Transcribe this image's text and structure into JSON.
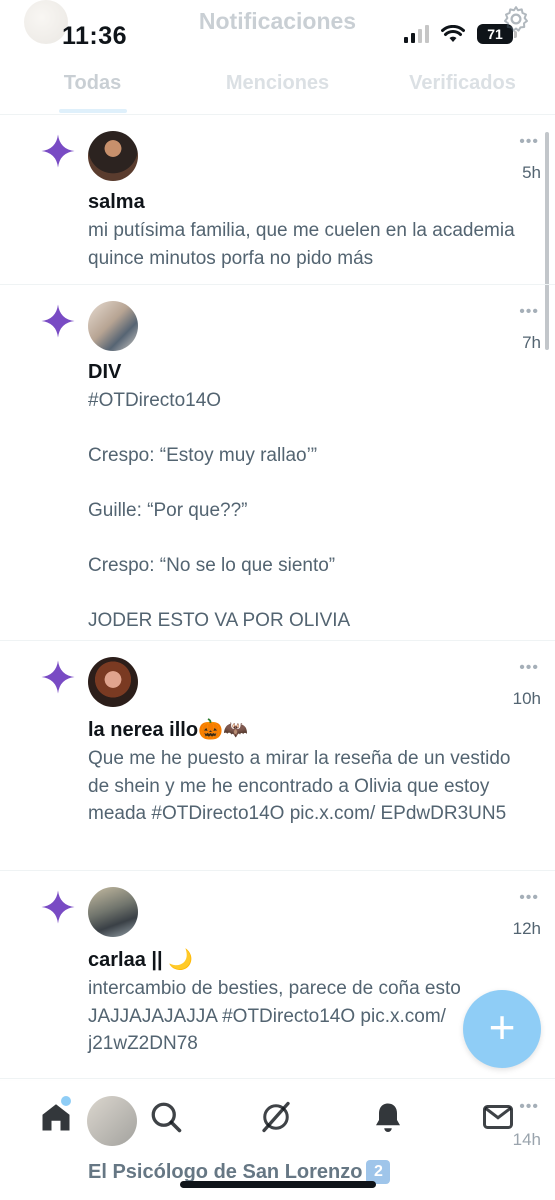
{
  "status_bar": {
    "time": "11:36",
    "battery": "71"
  },
  "header": {
    "title": "Notificaciones"
  },
  "tabs": [
    {
      "label": "Todas",
      "active": true
    },
    {
      "label": "Menciones",
      "active": false
    },
    {
      "label": "Verificados",
      "active": false
    }
  ],
  "notifications": [
    {
      "name": "salma",
      "time": "5h",
      "text": "mi putísima familia, que me cuelen en la academia quince minutos porfa no pido más"
    },
    {
      "name": "DIV",
      "time": "7h",
      "text": "#OTDirecto14O\n\nCrespo: “Estoy muy rallao’”\n\nGuille: “Por que??”\n\nCrespo: “No se lo que siento”\n\nJODER ESTO VA POR OLIVIA"
    },
    {
      "name": "la nerea illo🎃🦇",
      "time": "10h",
      "text": "Que me he puesto a mirar la reseña de un vestido de shein y me he encontrado a Olivia que estoy meada #OTDirecto14O pic.x.com/ EPdwDR3UN5"
    },
    {
      "name": "carlaa || 🌙",
      "time": "12h",
      "text": "intercambio de besties, parece de coña esto JAJJAJAJAJJA #OTDirecto14O pic.x.com/ j21wZ2DN78"
    }
  ],
  "peek": {
    "name": "El Psicólogo de San Lorenzo",
    "badge": "2",
    "time": "14h"
  },
  "fab": {
    "label": "+"
  },
  "colors": {
    "sparkle": "#794bc4",
    "fab": "#8fcdf6",
    "text_secondary": "#536471"
  },
  "icons": [
    "home-icon",
    "search-icon",
    "grok-icon",
    "bell-icon",
    "mail-icon",
    "gear-icon",
    "sparkle-icon"
  ]
}
